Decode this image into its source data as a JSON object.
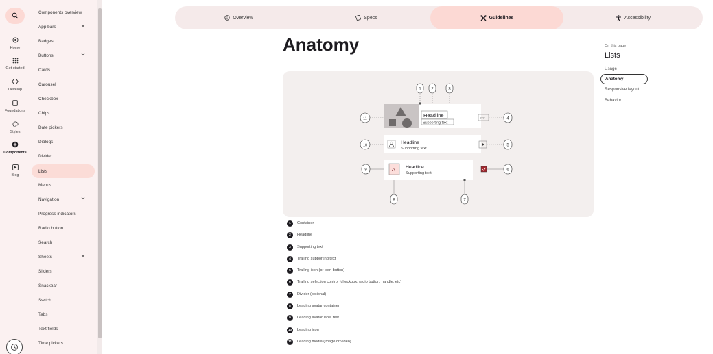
{
  "rail": {
    "items": [
      {
        "label": "Home",
        "icon": "home-icon"
      },
      {
        "label": "Get started",
        "icon": "grid-icon"
      },
      {
        "label": "Develop",
        "icon": "code-icon"
      },
      {
        "label": "Foundations",
        "icon": "book-icon"
      },
      {
        "label": "Styles",
        "icon": "palette-icon"
      },
      {
        "label": "Components",
        "icon": "components-icon"
      },
      {
        "label": "Blog",
        "icon": "blog-icon"
      }
    ]
  },
  "sidebar": {
    "items": [
      {
        "label": "Components overview"
      },
      {
        "label": "App bars",
        "expandable": true
      },
      {
        "label": "Badges"
      },
      {
        "label": "Buttons",
        "expandable": true
      },
      {
        "label": "Cards"
      },
      {
        "label": "Carousel"
      },
      {
        "label": "Checkbox"
      },
      {
        "label": "Chips"
      },
      {
        "label": "Date pickers"
      },
      {
        "label": "Dialogs"
      },
      {
        "label": "Divider"
      },
      {
        "label": "Lists",
        "active": true
      },
      {
        "label": "Menus"
      },
      {
        "label": "Navigation",
        "expandable": true
      },
      {
        "label": "Progress indicators"
      },
      {
        "label": "Radio button"
      },
      {
        "label": "Search"
      },
      {
        "label": "Sheets",
        "expandable": true
      },
      {
        "label": "Sliders"
      },
      {
        "label": "Snackbar"
      },
      {
        "label": "Switch"
      },
      {
        "label": "Tabs"
      },
      {
        "label": "Text fields"
      },
      {
        "label": "Time pickers"
      }
    ]
  },
  "tabs": [
    {
      "label": "Overview",
      "icon": "info-icon"
    },
    {
      "label": "Specs",
      "icon": "ruler-icon"
    },
    {
      "label": "Guidelines",
      "icon": "tools-icon",
      "active": true
    },
    {
      "label": "Accessibility",
      "icon": "accessibility-icon"
    }
  ],
  "page": {
    "title": "Anatomy"
  },
  "toc": {
    "kicker": "On this page",
    "title": "Lists",
    "items": [
      {
        "label": "Usage"
      },
      {
        "label": "Anatomy",
        "active": true
      },
      {
        "label": "Responsive layout"
      },
      {
        "label": "Behavior"
      }
    ]
  },
  "figure": {
    "headline": "Headline",
    "supporting": "Supporting text",
    "trailing_supporting": "100+",
    "avatar_letter": "A",
    "callouts": [
      "1",
      "2",
      "3",
      "4",
      "5",
      "6",
      "7",
      "8",
      "9",
      "10",
      "11"
    ]
  },
  "legend": [
    {
      "num": "1",
      "text": "Container"
    },
    {
      "num": "2",
      "text": "Headline"
    },
    {
      "num": "3",
      "text": "Supporting text"
    },
    {
      "num": "4",
      "text": "Trailing supporting text"
    },
    {
      "num": "5",
      "text": "Trailing icon (or icon button)"
    },
    {
      "num": "6",
      "text": "Trailing selection control (checkbox, radio button, handle, etc)"
    },
    {
      "num": "7",
      "text": "Divider (optional)"
    },
    {
      "num": "8",
      "text": "Leading avatar container"
    },
    {
      "num": "9",
      "text": "Leading avatar label text"
    },
    {
      "num": "10",
      "text": "Leading icon"
    },
    {
      "num": "11",
      "text": "Leading media (image or video)"
    }
  ],
  "colors": {
    "accent": "#fcd9d4",
    "surface": "#fbf1f1",
    "checkbox": "#a4262c"
  }
}
